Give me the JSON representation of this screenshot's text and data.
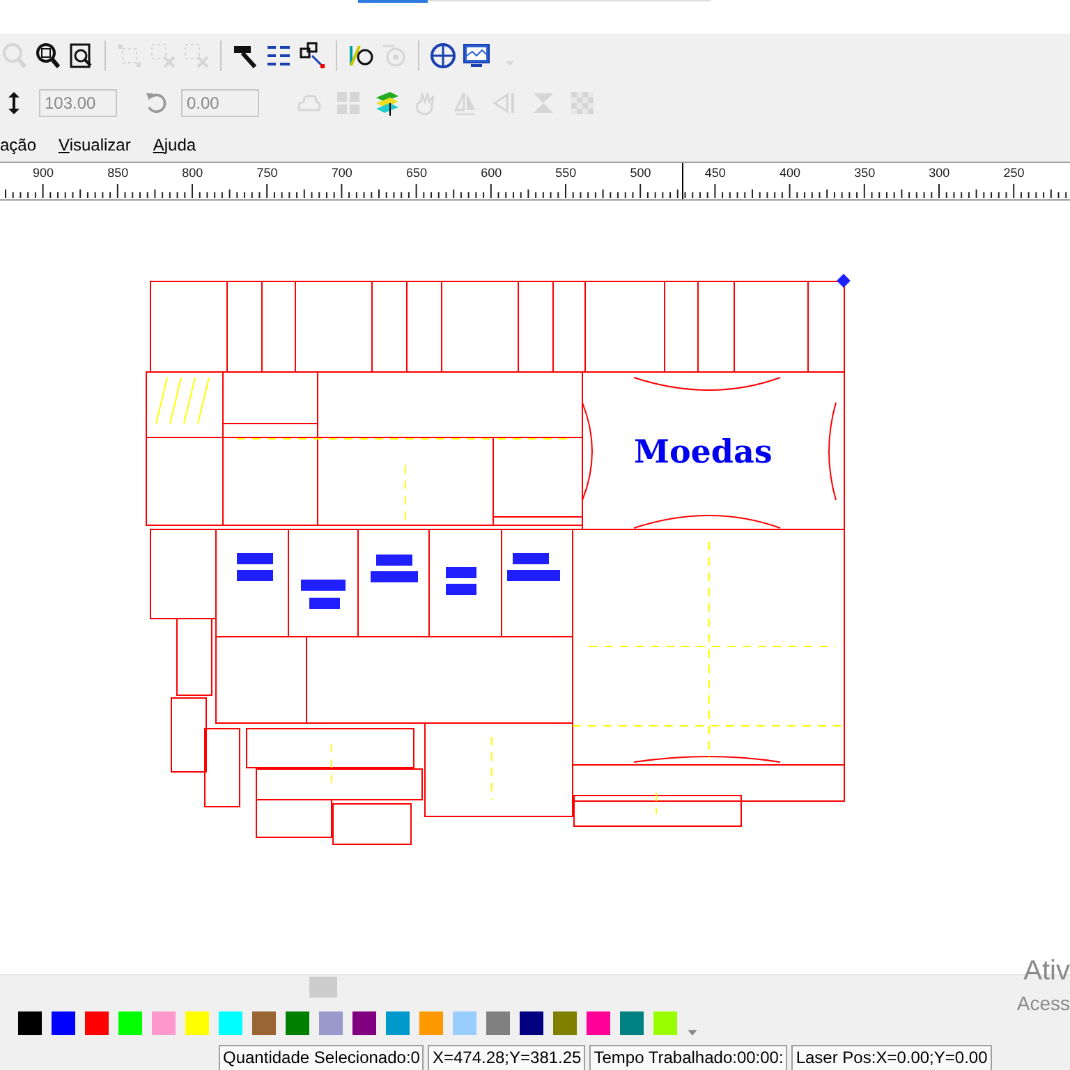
{
  "toolbar_top": [
    {
      "kind": "magnifier",
      "disabled": true
    },
    {
      "kind": "magnifier-box",
      "disabled": false
    },
    {
      "kind": "page",
      "disabled": false
    },
    {
      "kind": "sep"
    },
    {
      "kind": "nodes",
      "disabled": true
    },
    {
      "kind": "nodes-x",
      "disabled": true
    },
    {
      "kind": "nodes-x",
      "disabled": true
    },
    {
      "kind": "sep"
    },
    {
      "kind": "hammer",
      "disabled": false
    },
    {
      "kind": "list",
      "disabled": false
    },
    {
      "kind": "node-arrow",
      "disabled": false
    },
    {
      "kind": "sep"
    },
    {
      "kind": "curve",
      "disabled": false
    },
    {
      "kind": "dial",
      "disabled": true
    },
    {
      "kind": "sep"
    },
    {
      "kind": "target",
      "disabled": false
    },
    {
      "kind": "monitor",
      "disabled": false
    },
    {
      "kind": "caret",
      "disabled": true
    }
  ],
  "size_row": {
    "height_value": "103.00",
    "height_disabled": true,
    "rotate_value": "0.00",
    "rotate_disabled": true,
    "tools": [
      {
        "kind": "cloud",
        "disabled": true
      },
      {
        "kind": "grid",
        "disabled": true
      },
      {
        "kind": "layers",
        "disabled": false
      },
      {
        "kind": "hand",
        "disabled": true
      },
      {
        "kind": "mirror",
        "disabled": true
      },
      {
        "kind": "arrow",
        "disabled": true
      },
      {
        "kind": "hourglass",
        "disabled": true
      },
      {
        "kind": "checker",
        "disabled": true
      }
    ]
  },
  "menu": [
    {
      "label": "ação",
      "mnemonic": false
    },
    {
      "label": "Visualizar",
      "mnemonic": true
    },
    {
      "label": "Ajuda",
      "mnemonic": true
    }
  ],
  "ruler": {
    "labels": [
      "900",
      "850",
      "800",
      "750",
      "700",
      "650",
      "600",
      "550",
      "500",
      "450",
      "400",
      "350",
      "300",
      "250"
    ]
  },
  "canvas": {
    "engraving_text": "Moedas"
  },
  "palette": [
    {
      "color": "#000000"
    },
    {
      "color": "#0000ff"
    },
    {
      "color": "#ff0000"
    },
    {
      "color": "#00ff00"
    },
    {
      "color": "#ff99cc"
    },
    {
      "color": "#ffff00"
    },
    {
      "color": "#00ffff"
    },
    {
      "color": "#996633"
    },
    {
      "color": "#008000"
    },
    {
      "color": "#9999cc"
    },
    {
      "color": "#800080"
    },
    {
      "color": "#0099cc"
    },
    {
      "color": "#ff9900"
    },
    {
      "color": "#99ccff"
    },
    {
      "color": "#808080"
    },
    {
      "color": "#000080"
    },
    {
      "color": "#808000"
    },
    {
      "color": "#ff0099"
    },
    {
      "color": "#008080"
    },
    {
      "color": "#99ff00"
    }
  ],
  "overlay": {
    "line_1": "Ativ",
    "line_2": "Acess"
  },
  "status_bar": [
    "Quantidade Selecionado:0",
    "X=474.28;Y=381.25",
    "Tempo Trabalhado:00:00:",
    "Laser Pos:X=0.00;Y=0.00"
  ]
}
